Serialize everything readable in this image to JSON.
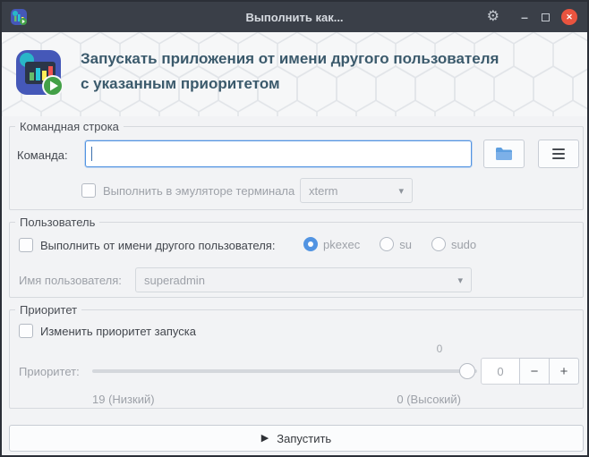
{
  "window": {
    "title": "Выполнить как..."
  },
  "icons": {
    "gear": "⚙",
    "minimize": "–",
    "close": "✕",
    "dropdown_arrow": "▾",
    "run_play": "▶"
  },
  "colors": {
    "accent": "#5294e2",
    "titlebar": "#3a3f48",
    "close_button": "#e9543f",
    "header_title": "#3b5a6c"
  },
  "header": {
    "title_line1": "Запускать приложения от имени другого пользователя",
    "title_line2": "с указанным приоритетом"
  },
  "command_group": {
    "title": "Командная строка",
    "command_label": "Команда:",
    "command_value": "",
    "terminal_checkbox_label": "Выполнить в эмуляторе терминала",
    "terminal_select_value": "xterm"
  },
  "user_group": {
    "title": "Пользователь",
    "checkbox_label": "Выполнить от имени другого пользователя:",
    "radios": [
      {
        "label": "pkexec",
        "selected": true
      },
      {
        "label": "su",
        "selected": false
      },
      {
        "label": "sudo",
        "selected": false
      }
    ],
    "username_label": "Имя пользователя:",
    "username_value": "superadmin"
  },
  "priority_group": {
    "title": "Приоритет",
    "checkbox_label": "Изменить приоритет запуска",
    "priority_label": "Приоритет:",
    "slider_hint": "0",
    "spin_value": "0",
    "minus": "−",
    "plus": "+",
    "low_label": "19 (Низкий)",
    "high_label": "0 (Высокий)"
  },
  "run_button": {
    "label": "Запустить"
  }
}
